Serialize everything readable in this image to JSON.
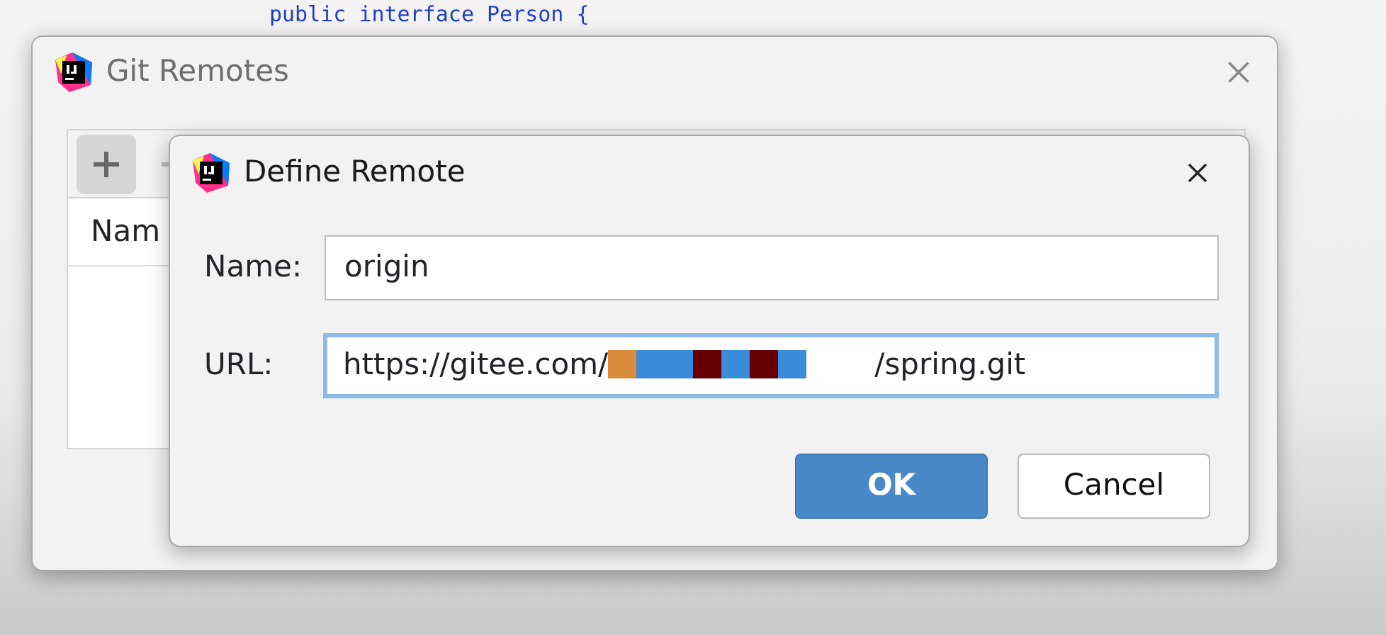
{
  "editor": {
    "code_line": "public interface Person {"
  },
  "git_remotes_window": {
    "title": "Git Remotes",
    "column_header": "Nam"
  },
  "define_remote_dialog": {
    "title": "Define Remote",
    "fields": [
      {
        "label": "Name:",
        "value_start": "origin",
        "focused": false,
        "redacted": false
      },
      {
        "label": "URL:",
        "value_start": "https://gitee.com/",
        "value_end": "/spring.git",
        "focused": true,
        "redacted": true
      }
    ],
    "buttons": [
      {
        "label": "OK",
        "default": true
      },
      {
        "label": "Cancel",
        "default": false
      }
    ]
  }
}
